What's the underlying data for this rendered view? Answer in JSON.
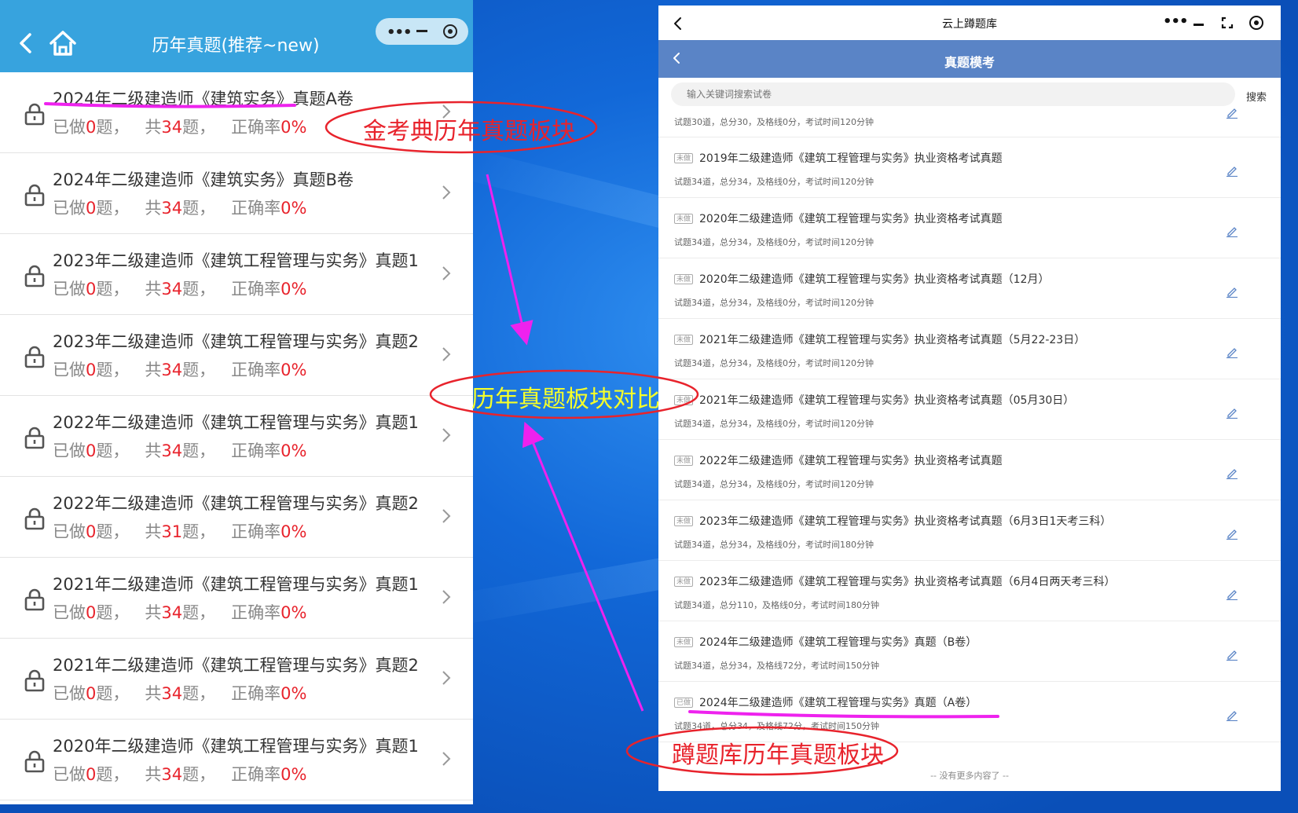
{
  "left_panel": {
    "title": "历年真题(推荐~new)",
    "items": [
      {
        "title": "2024年二级建造师《建筑实务》真题A卷",
        "done": "0",
        "total": "34",
        "rate": "0%"
      },
      {
        "title": "2024年二级建造师《建筑实务》真题B卷",
        "done": "0",
        "total": "34",
        "rate": "0%"
      },
      {
        "title": "2023年二级建造师《建筑工程管理与实务》真题1",
        "done": "0",
        "total": "34",
        "rate": "0%"
      },
      {
        "title": "2023年二级建造师《建筑工程管理与实务》真题2",
        "done": "0",
        "total": "34",
        "rate": "0%"
      },
      {
        "title": "2022年二级建造师《建筑工程管理与实务》真题1",
        "done": "0",
        "total": "34",
        "rate": "0%"
      },
      {
        "title": "2022年二级建造师《建筑工程管理与实务》真题2",
        "done": "0",
        "total": "31",
        "rate": "0%"
      },
      {
        "title": "2021年二级建造师《建筑工程管理与实务》真题1",
        "done": "0",
        "total": "34",
        "rate": "0%"
      },
      {
        "title": "2021年二级建造师《建筑工程管理与实务》真题2",
        "done": "0",
        "total": "34",
        "rate": "0%"
      },
      {
        "title": "2020年二级建造师《建筑工程管理与实务》真题1",
        "done": "0",
        "total": "34",
        "rate": "0%"
      }
    ],
    "labels": {
      "done_prefix": "已做",
      "done_suffix": "题，",
      "total_prefix": "共",
      "total_suffix": "题，",
      "rate_prefix": "正确率"
    }
  },
  "right_panel": {
    "app_name": "云上蹲题库",
    "nav_title": "真题模考",
    "search_placeholder": "输入关键词搜索试卷",
    "search_button": "搜索",
    "items": [
      {
        "badge": "",
        "title": "",
        "sub": "试题30道，总分30，及格线0分，考试时间120分钟"
      },
      {
        "badge": "未做",
        "title": "2019年二级建造师《建筑工程管理与实务》执业资格考试真题",
        "sub": "试题34道，总分34，及格线0分，考试时间120分钟"
      },
      {
        "badge": "未做",
        "title": "2020年二级建造师《建筑工程管理与实务》执业资格考试真题",
        "sub": "试题34道，总分34，及格线0分，考试时间120分钟"
      },
      {
        "badge": "未做",
        "title": "2020年二级建造师《建筑工程管理与实务》执业资格考试真题（12月）",
        "sub": "试题34道，总分34，及格线0分，考试时间120分钟"
      },
      {
        "badge": "未做",
        "title": "2021年二级建造师《建筑工程管理与实务》执业资格考试真题（5月22-23日）",
        "sub": "试题34道，总分34，及格线0分，考试时间120分钟"
      },
      {
        "badge": "未做",
        "title": "2021年二级建造师《建筑工程管理与实务》执业资格考试真题（05月30日）",
        "sub": "试题34道，总分34，及格线0分，考试时间120分钟"
      },
      {
        "badge": "未做",
        "title": "2022年二级建造师《建筑工程管理与实务》执业资格考试真题",
        "sub": "试题34道，总分34，及格线0分，考试时间120分钟"
      },
      {
        "badge": "未做",
        "title": "2023年二级建造师《建筑工程管理与实务》执业资格考试真题（6月3日1天考三科）",
        "sub": "试题34道，总分34，及格线0分，考试时间180分钟"
      },
      {
        "badge": "未做",
        "title": "2023年二级建造师《建筑工程管理与实务》执业资格考试真题（6月4日两天考三科）",
        "sub": "试题34道，总分110，及格线0分，考试时间180分钟"
      },
      {
        "badge": "未做",
        "title": "2024年二级建造师《建筑工程管理与实务》真题（B卷）",
        "sub": "试题34道，总分34，及格线72分，考试时间150分钟"
      },
      {
        "badge": "已做",
        "title": "2024年二级建造师《建筑工程管理与实务》真题（A卷）",
        "sub": "试题34道，总分34，及格线72分，考试时间150分钟"
      }
    ],
    "no_more": "-- 没有更多内容了 --"
  },
  "annotations": {
    "left_label": "金考典历年真题板块",
    "center_label": "历年真题板块对比",
    "right_label": "蹲题库历年真题板块",
    "red": "#e8232c",
    "magenta": "#ee22ee",
    "yellow": "#f5ff2a"
  }
}
